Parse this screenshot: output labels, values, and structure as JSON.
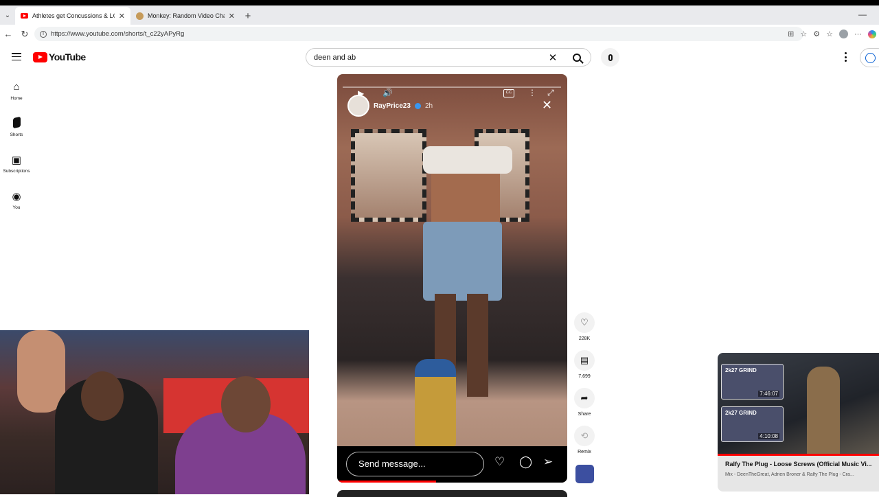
{
  "browser": {
    "tabs": [
      {
        "title": "Athletes get Concussions & LOSE",
        "active": true
      },
      {
        "title": "Monkey: Random Video Chat | Tal",
        "active": false
      }
    ],
    "url": "https://www.youtube.com/shorts/t_c22yAPyRg"
  },
  "youtube": {
    "logo_text": "YouTube",
    "search_value": "deen and ab",
    "guide": [
      {
        "icon": "home-icon",
        "label": "Home"
      },
      {
        "icon": "shorts-icon",
        "label": "Shorts"
      },
      {
        "icon": "subscriptions-icon",
        "label": "Subscriptions"
      },
      {
        "icon": "you-icon",
        "label": "You"
      }
    ]
  },
  "short": {
    "story_user": "RayPrice23",
    "story_time": "2h",
    "message_placeholder": "Send message...",
    "progress_fraction": 0.43,
    "actions": {
      "like_count": "228K",
      "comment_count": "7,699",
      "share_label": "Share",
      "remix_label": "Remix"
    }
  },
  "miniplayer": {
    "title": "Ralfy The Plug - Loose Screws (Official Music Vi...",
    "subtitle": "Mix - DeenTheGreat, Adrien Broner & Ralfy The Plug - Cra...",
    "thumbs": [
      {
        "label": "2k27 GRIND",
        "duration": "7:46:07"
      },
      {
        "label": "2k27 GRIND",
        "duration": "4:10:08"
      }
    ]
  },
  "colors": {
    "brand_red": "#ff0000",
    "verified_blue": "#3897f0"
  }
}
